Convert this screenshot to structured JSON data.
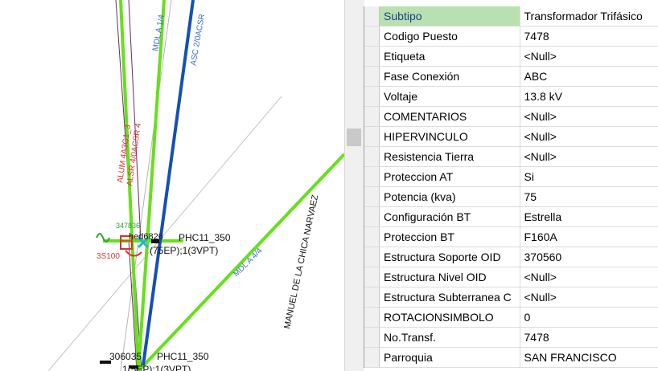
{
  "map": {
    "labels": {
      "top_line_1": "MDL A 1/4",
      "blue_line": "ASC 2/0ACSR",
      "red_line_1": "ALUM 4A3G1_3",
      "red_line_2": "ALSR 4/0ACSR 4",
      "street": "MANUEL DE LA CHICA NARVAEZ",
      "green_diag": "MDL A 4/4",
      "node_top_id": "347836",
      "node_top_name": "hed6826",
      "node_top_code": "PHC11_350",
      "node_top_desc": "(75EP);1(3VPT)",
      "node_left": "3S100",
      "node_bottom_id": "306035",
      "node_bottom_code": "PHC11_350",
      "node_bottom_desc": "1(5EP);1(3VPT)"
    },
    "colors": {
      "green_line": "#66e01a",
      "blue_line": "#1550b4",
      "red_label": "#e03030",
      "blue_label": "#2a5ec0",
      "gray_line": "#b0b0b0",
      "purple_line": "#6b2a6b"
    }
  },
  "properties": {
    "rows": [
      {
        "key": "Subtipo",
        "value": "Transformador Trifásico"
      },
      {
        "key": "Codigo Puesto",
        "value": "7478"
      },
      {
        "key": "Etiqueta",
        "value": "<Null>"
      },
      {
        "key": "Fase Conexión",
        "value": "ABC"
      },
      {
        "key": "Voltaje",
        "value": "13.8 kV"
      },
      {
        "key": "COMENTARIOS",
        "value": "<Null>"
      },
      {
        "key": "HIPERVINCULO",
        "value": "<Null>"
      },
      {
        "key": "Resistencia Tierra",
        "value": "<Null>"
      },
      {
        "key": "Proteccion AT",
        "value": "Si"
      },
      {
        "key": "Potencia (kva)",
        "value": "75"
      },
      {
        "key": "Configuración BT",
        "value": "Estrella"
      },
      {
        "key": "Proteccion BT",
        "value": "F160A"
      },
      {
        "key": "Estructura Soporte OID",
        "value": "370560"
      },
      {
        "key": "Estructura Nivel OID",
        "value": "<Null>"
      },
      {
        "key": "Estructura Subterranea C",
        "value": "<Null>"
      },
      {
        "key": "ROTACIONSIMBOLO",
        "value": "0"
      },
      {
        "key": "No.Transf.",
        "value": "7478"
      },
      {
        "key": "Parroquia",
        "value": "SAN FRANCISCO"
      }
    ]
  }
}
